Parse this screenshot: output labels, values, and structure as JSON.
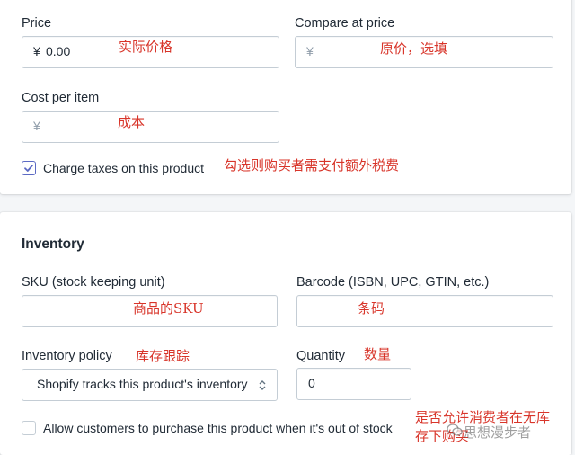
{
  "pricing": {
    "price": {
      "label": "Price",
      "prefix": "¥",
      "value": "0.00",
      "annotation": "实际价格"
    },
    "compare_at": {
      "label": "Compare at price",
      "prefix": "¥",
      "value": "",
      "annotation": "原价，选填"
    },
    "cost": {
      "label": "Cost per item",
      "prefix": "¥",
      "value": "",
      "annotation": "成本"
    },
    "charge_taxes": {
      "label": "Charge taxes on this product",
      "checked": true,
      "annotation": "勾选则购买者需支付额外税费"
    }
  },
  "inventory": {
    "title": "Inventory",
    "sku": {
      "label": "SKU (stock keeping unit)",
      "value": "",
      "annotation": "商品的SKU"
    },
    "barcode": {
      "label": "Barcode (ISBN, UPC, GTIN, etc.)",
      "value": "",
      "annotation": "条码"
    },
    "policy": {
      "label": "Inventory policy",
      "selected": "Shopify tracks this product's inventory",
      "annotation": "库存跟踪"
    },
    "quantity": {
      "label": "Quantity",
      "value": "0",
      "annotation": "数量"
    },
    "oversell": {
      "label": "Allow customers to purchase this product when it's out of stock",
      "checked": false,
      "annotation_line1": "是否允许消费者在无库",
      "annotation_line2": "存下购买"
    }
  },
  "watermark": {
    "text": "思想漫步者",
    "icon": "wechat-icon"
  },
  "colors": {
    "accent": "#5c6ac4",
    "annotation": "#d8352a",
    "border": "#c4cdd5"
  }
}
